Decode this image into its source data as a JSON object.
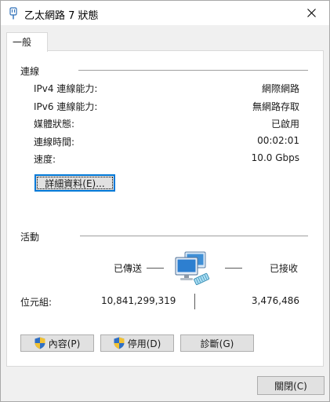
{
  "window": {
    "title": "乙太網路 7 狀態"
  },
  "tabs": [
    {
      "label": "一般"
    }
  ],
  "connection": {
    "heading": "連線",
    "rows": [
      {
        "label": "IPv4 連線能力:",
        "value": "網際網路"
      },
      {
        "label": "IPv6 連線能力:",
        "value": "無網路存取"
      },
      {
        "label": "媒體狀態:",
        "value": "已啟用"
      },
      {
        "label": "連線時間:",
        "value": "00:02:01"
      },
      {
        "label": "速度:",
        "value": "10.0 Gbps"
      }
    ],
    "details_button": "詳細資料(E)..."
  },
  "activity": {
    "heading": "活動",
    "sent_label": "已傳送",
    "received_label": "已接收",
    "bytes_label": "位元組:",
    "bytes_sent": "10,841,299,319",
    "bytes_received": "3,476,486"
  },
  "buttons": {
    "properties": "內容(P)",
    "disable": "停用(D)",
    "diagnose": "診斷(G)",
    "close": "關閉(C)"
  },
  "icons": {
    "title": "network-adapter-icon",
    "shield": "uac-shield-icon",
    "activity": "network-computers-icon"
  }
}
